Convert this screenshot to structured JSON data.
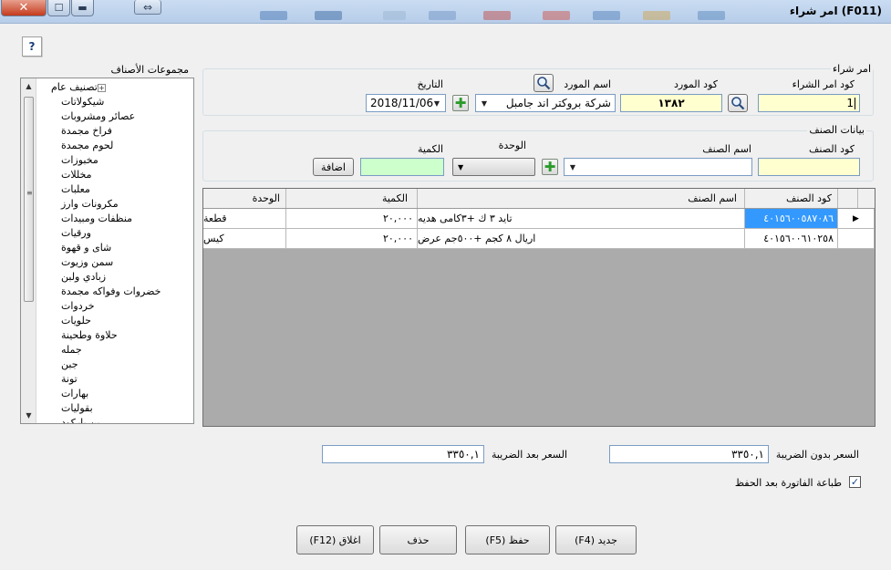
{
  "window": {
    "title": "امر شراء",
    "form_code": "(F011)"
  },
  "help_label": "?",
  "tree": {
    "label": "مجموعات الأصناف",
    "root": "تصنيف عام",
    "items": [
      "شيكولاتات",
      "عصائر ومشروبات",
      "فراخ مجمدة",
      "لحوم مجمدة",
      "مخبوزات",
      "مخللات",
      "معلبات",
      "مكرونات وارز",
      "منظفات ومبيدات",
      "ورقيات",
      "شاى و قهوة",
      "سمن وزيوت",
      "زبادي ولبن",
      "خضروات وفواكه مجمدة",
      "خردوات",
      "حلويات",
      "حلاوة وطحينة",
      "جمله",
      "جبن",
      "تونة",
      "بهارات",
      "بقوليات",
      "بن باركود"
    ]
  },
  "order": {
    "group_title": "امر شراء",
    "order_code_label": "كود امر الشراء",
    "order_code_value": "1",
    "supplier_code_label": "كود المورد",
    "supplier_code_value": "١٣٨٢",
    "supplier_name_label": "اسم المورد",
    "supplier_name_value": "شركة بروكتر اند جامبل",
    "date_label": "التاريخ",
    "date_value": "2018/11/06"
  },
  "item_data": {
    "group_title": "بيانات الصنف",
    "item_code_label": "كود الصنف",
    "item_code_value": "",
    "item_name_label": "اسم الصنف",
    "item_name_value": "",
    "unit_label": "الوحدة",
    "quantity_label": "الكمية",
    "quantity_value": "",
    "add_label": "اضافة"
  },
  "grid": {
    "columns": [
      "كود الصنف",
      "اسم الصنف",
      "الكمية",
      "الوحدة"
    ],
    "rows": [
      {
        "code": "٤٠١٥٦٠٠٥٨٧٠٨٦",
        "name": "تايد ٣ ك +٣كامى هديه",
        "qty": "٢٠,٠٠٠",
        "unit": "قطعة"
      },
      {
        "code": "٤٠١٥٦٠٠٦١٠٢٥٨",
        "name": "اريال ٨ كجم +٥٠٠جم عرض",
        "qty": "٢٠,٠٠٠",
        "unit": "كيس"
      }
    ]
  },
  "totals": {
    "before_tax_label": "السعر بدون الضريبة",
    "before_tax_value": "٣٣٥٠,١",
    "after_tax_label": "السعر بعد الضريبة",
    "after_tax_value": "٣٣٥٠,١",
    "print_label": "طباعة الفاتورة بعد الحفظ",
    "print_checked": true
  },
  "buttons": {
    "new": "جديد (F4)",
    "save": "حفظ (F5)",
    "delete": "حذف",
    "close": "اغلاق (F12)"
  },
  "colors": {
    "selection": "#3399ff",
    "yellow_field": "#ffffd0",
    "green_field": "#ccffcc",
    "grid_bg": "#ababab"
  }
}
